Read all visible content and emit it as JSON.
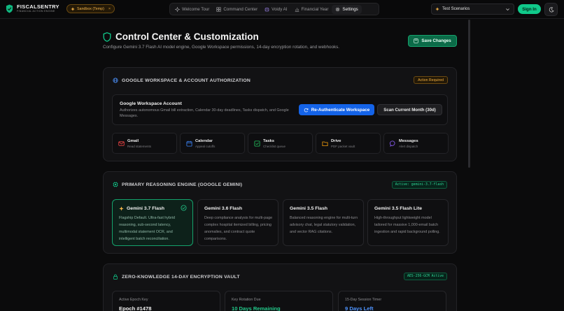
{
  "brand": {
    "name": "FISCALSENTRY",
    "tagline": "FINANCIAL ACTION ENGINE"
  },
  "sandbox": {
    "label": "Sandbox (Temp)",
    "close": "×"
  },
  "nav": [
    {
      "label": "Welcome Tour",
      "icon": "sparkle-icon"
    },
    {
      "label": "Command Center",
      "icon": "grid-icon"
    },
    {
      "label": "Voidy AI",
      "icon": "bot-icon"
    },
    {
      "label": "Financial Year",
      "icon": "bar-chart-icon"
    },
    {
      "label": "Settings",
      "icon": "gear-icon",
      "active": true
    }
  ],
  "scenarios": {
    "selected": "Test Scenarios"
  },
  "auth": {
    "signin": "Sign In"
  },
  "header": {
    "title": "Control Center & Customization",
    "subtitle": "Configure Gemini 3.7 Flash AI model engine, Google Workspace permissions, 14-day encryption rotation, and webhooks.",
    "save": "Save Changes"
  },
  "workspace": {
    "heading": "GOOGLE WORKSPACE & ACCOUNT AUTHORIZATION",
    "badge": "Action Required",
    "account_title": "Google Workspace Account",
    "account_desc": "Authorizes autonomous Gmail bill extraction, Calendar 30-day deadlines, Tasks dispatch, and Google Messages.",
    "reauth": "Re-Authenticate Workspace",
    "scan": "Scan Current Month (30d)",
    "services": [
      {
        "name": "Gmail",
        "desc": "Read statements",
        "icon": "mail-icon",
        "color": "#ef4444"
      },
      {
        "name": "Calendar",
        "desc": "Appeal cutoffs",
        "icon": "calendar-icon",
        "color": "#3b82f6"
      },
      {
        "name": "Tasks",
        "desc": "Checklist queue",
        "icon": "checkbox-icon",
        "color": "#22c55e"
      },
      {
        "name": "Drive",
        "desc": "PDF packet vault",
        "icon": "folder-icon",
        "color": "#f59e0b"
      },
      {
        "name": "Messages",
        "desc": "Alert dispatch",
        "icon": "message-icon",
        "color": "#8b5cf6"
      }
    ]
  },
  "engine": {
    "heading": "PRIMARY REASONING ENGINE (GOOGLE GEMINI)",
    "badge": "Active: gemini-3.7-flash",
    "models": [
      {
        "name": "Gemini 3.7 Flash",
        "selected": true,
        "desc": "Flagship Default. Ultra-fast hybrid reasoning, sub-second latency, multimodal statement OCR, and intelligent batch reconciliation."
      },
      {
        "name": "Gemini 3.6 Flash",
        "desc": "Deep compliance analysis for multi-page complex hospital itemized billing, pricing anomalies, and contract quote comparisons."
      },
      {
        "name": "Gemini 3.5 Flash",
        "desc": "Balanced reasoning engine for multi-turn advisory chat, legal statutory validation, and vector RAG citations."
      },
      {
        "name": "Gemini 3.5 Flash Lite",
        "desc": "High-throughput lightweight model tailored for massive 1,000-email batch ingestion and rapid background polling."
      }
    ]
  },
  "vault": {
    "heading": "ZERO-KNOWLEDGE 14-DAY ENCRYPTION VAULT",
    "badge": "AES-256-GCM Active",
    "cards": [
      {
        "label": "Active Epoch Key",
        "value": "Epoch #1478"
      },
      {
        "label": "Key Rotation Due",
        "value": "10 Days Remaining"
      },
      {
        "label": "15-Day Session Timer",
        "value": "9 Days Left"
      }
    ]
  }
}
